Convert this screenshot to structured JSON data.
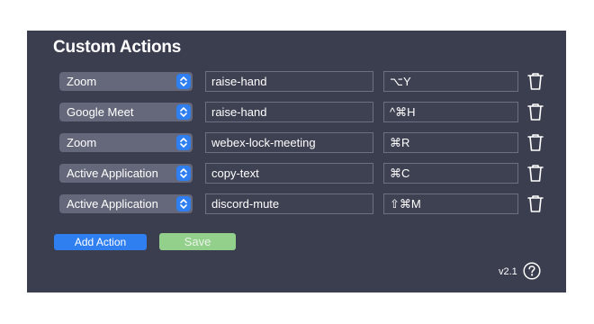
{
  "title": "Custom Actions",
  "rows": [
    {
      "app": "Zoom",
      "action": "raise-hand",
      "shortcut": "⌥Y"
    },
    {
      "app": "Google Meet",
      "action": "raise-hand",
      "shortcut": "^⌘H"
    },
    {
      "app": "Zoom",
      "action": "webex-lock-meeting",
      "shortcut": "⌘R"
    },
    {
      "app": "Active Application",
      "action": "copy-text",
      "shortcut": "⌘C"
    },
    {
      "app": "Active Application",
      "action": "discord-mute",
      "shortcut": "⇧⌘M"
    }
  ],
  "buttons": {
    "add_label": "Add Action",
    "save_label": "Save"
  },
  "version": "v2.1",
  "icons": {
    "select": "chevron-updown-icon",
    "delete": "trash-icon",
    "help": "help-circle-icon"
  },
  "colors": {
    "panel_bg": "#3b3e4f",
    "accent": "#2f7ff0",
    "save": "#93d08c"
  }
}
